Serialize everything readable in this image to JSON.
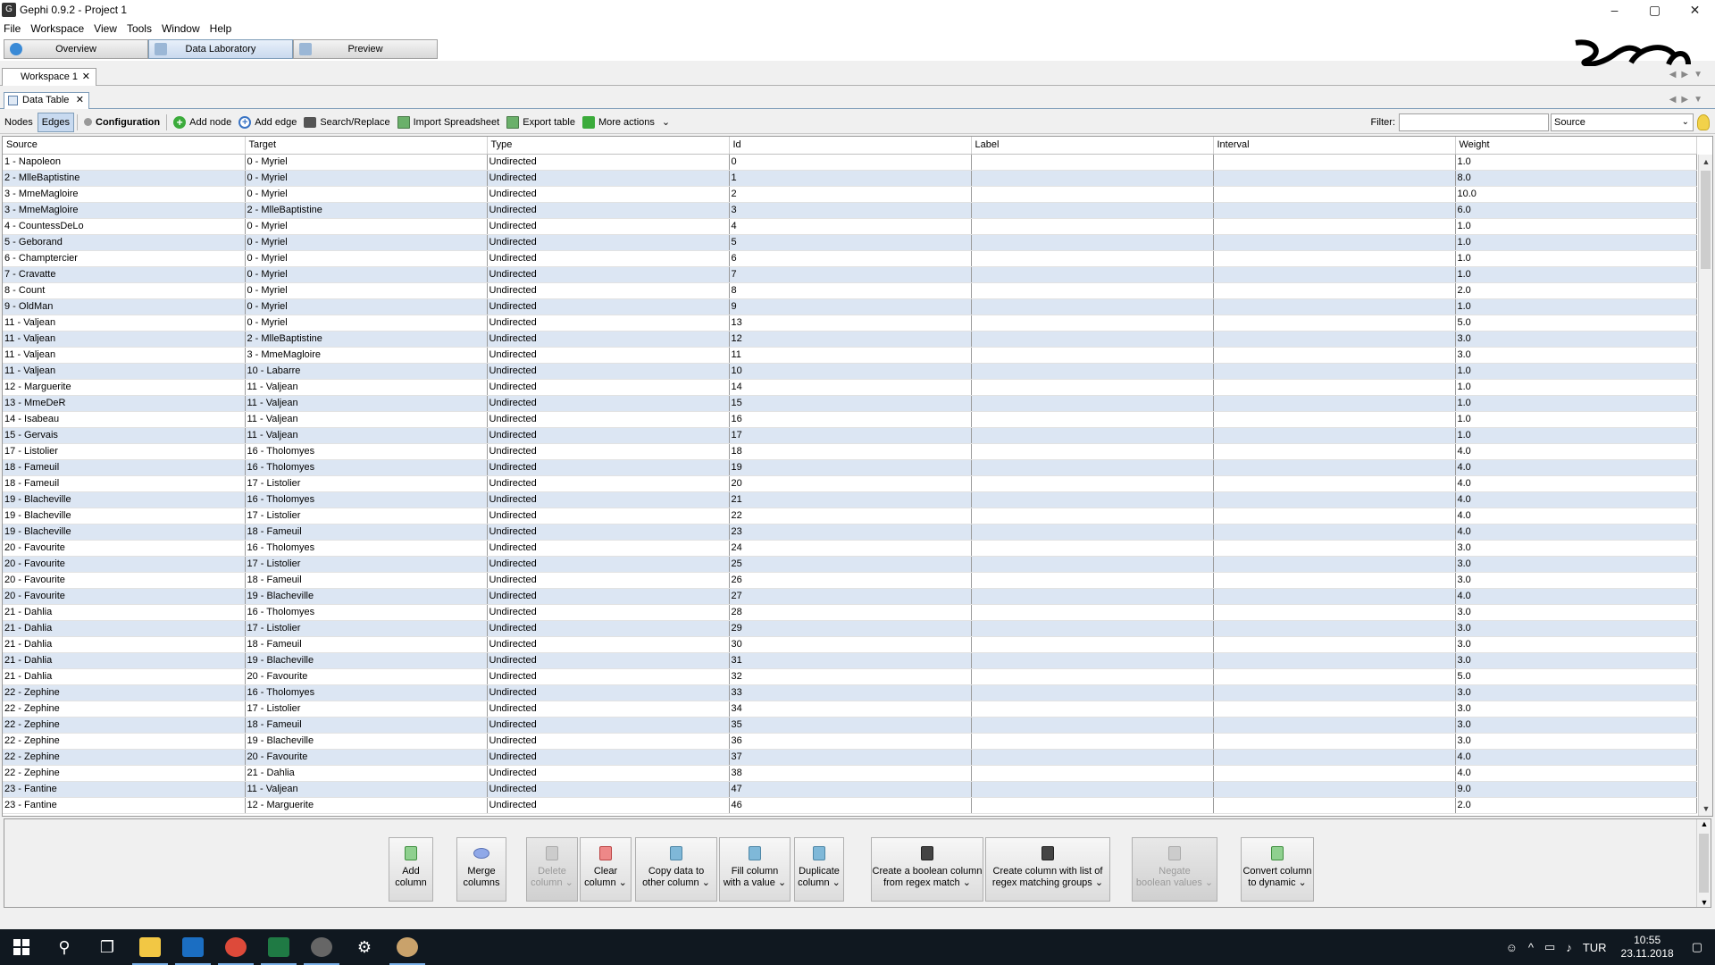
{
  "window": {
    "title": "Gephi 0.9.2 - Project 1",
    "min": "–",
    "max": "▢",
    "close": "✕"
  },
  "menu": [
    "File",
    "Workspace",
    "View",
    "Tools",
    "Window",
    "Help"
  ],
  "modes": [
    {
      "label": "Overview",
      "active": false
    },
    {
      "label": "Data Laboratory",
      "active": true
    },
    {
      "label": "Preview",
      "active": false
    }
  ],
  "workspace_tab": {
    "label": "Workspace 1",
    "close": "✕"
  },
  "panel_tab": {
    "label": "Data Table",
    "close": "✕"
  },
  "toolbar": {
    "nodes": "Nodes",
    "edges": "Edges",
    "configuration": "Configuration",
    "add_node": "Add node",
    "add_edge": "Add edge",
    "search_replace": "Search/Replace",
    "import_spreadsheet": "Import Spreadsheet",
    "export_table": "Export table",
    "more_actions": "More actions",
    "filter_label": "Filter:",
    "filter_value": "",
    "filter_column": "Source"
  },
  "table": {
    "columns": [
      "Source",
      "Target",
      "Type",
      "Id",
      "Label",
      "Interval",
      "Weight"
    ],
    "rows": [
      [
        "1 - Napoleon",
        "0 - Myriel",
        "Undirected",
        "0",
        "",
        "",
        "1.0"
      ],
      [
        "2 - MlleBaptistine",
        "0 - Myriel",
        "Undirected",
        "1",
        "",
        "",
        "8.0"
      ],
      [
        "3 - MmeMagloire",
        "0 - Myriel",
        "Undirected",
        "2",
        "",
        "",
        "10.0"
      ],
      [
        "3 - MmeMagloire",
        "2 - MlleBaptistine",
        "Undirected",
        "3",
        "",
        "",
        "6.0"
      ],
      [
        "4 - CountessDeLo",
        "0 - Myriel",
        "Undirected",
        "4",
        "",
        "",
        "1.0"
      ],
      [
        "5 - Geborand",
        "0 - Myriel",
        "Undirected",
        "5",
        "",
        "",
        "1.0"
      ],
      [
        "6 - Champtercier",
        "0 - Myriel",
        "Undirected",
        "6",
        "",
        "",
        "1.0"
      ],
      [
        "7 - Cravatte",
        "0 - Myriel",
        "Undirected",
        "7",
        "",
        "",
        "1.0"
      ],
      [
        "8 - Count",
        "0 - Myriel",
        "Undirected",
        "8",
        "",
        "",
        "2.0"
      ],
      [
        "9 - OldMan",
        "0 - Myriel",
        "Undirected",
        "9",
        "",
        "",
        "1.0"
      ],
      [
        "11 - Valjean",
        "0 - Myriel",
        "Undirected",
        "13",
        "",
        "",
        "5.0"
      ],
      [
        "11 - Valjean",
        "2 - MlleBaptistine",
        "Undirected",
        "12",
        "",
        "",
        "3.0"
      ],
      [
        "11 - Valjean",
        "3 - MmeMagloire",
        "Undirected",
        "11",
        "",
        "",
        "3.0"
      ],
      [
        "11 - Valjean",
        "10 - Labarre",
        "Undirected",
        "10",
        "",
        "",
        "1.0"
      ],
      [
        "12 - Marguerite",
        "11 - Valjean",
        "Undirected",
        "14",
        "",
        "",
        "1.0"
      ],
      [
        "13 - MmeDeR",
        "11 - Valjean",
        "Undirected",
        "15",
        "",
        "",
        "1.0"
      ],
      [
        "14 - Isabeau",
        "11 - Valjean",
        "Undirected",
        "16",
        "",
        "",
        "1.0"
      ],
      [
        "15 - Gervais",
        "11 - Valjean",
        "Undirected",
        "17",
        "",
        "",
        "1.0"
      ],
      [
        "17 - Listolier",
        "16 - Tholomyes",
        "Undirected",
        "18",
        "",
        "",
        "4.0"
      ],
      [
        "18 - Fameuil",
        "16 - Tholomyes",
        "Undirected",
        "19",
        "",
        "",
        "4.0"
      ],
      [
        "18 - Fameuil",
        "17 - Listolier",
        "Undirected",
        "20",
        "",
        "",
        "4.0"
      ],
      [
        "19 - Blacheville",
        "16 - Tholomyes",
        "Undirected",
        "21",
        "",
        "",
        "4.0"
      ],
      [
        "19 - Blacheville",
        "17 - Listolier",
        "Undirected",
        "22",
        "",
        "",
        "4.0"
      ],
      [
        "19 - Blacheville",
        "18 - Fameuil",
        "Undirected",
        "23",
        "",
        "",
        "4.0"
      ],
      [
        "20 - Favourite",
        "16 - Tholomyes",
        "Undirected",
        "24",
        "",
        "",
        "3.0"
      ],
      [
        "20 - Favourite",
        "17 - Listolier",
        "Undirected",
        "25",
        "",
        "",
        "3.0"
      ],
      [
        "20 - Favourite",
        "18 - Fameuil",
        "Undirected",
        "26",
        "",
        "",
        "3.0"
      ],
      [
        "20 - Favourite",
        "19 - Blacheville",
        "Undirected",
        "27",
        "",
        "",
        "4.0"
      ],
      [
        "21 - Dahlia",
        "16 - Tholomyes",
        "Undirected",
        "28",
        "",
        "",
        "3.0"
      ],
      [
        "21 - Dahlia",
        "17 - Listolier",
        "Undirected",
        "29",
        "",
        "",
        "3.0"
      ],
      [
        "21 - Dahlia",
        "18 - Fameuil",
        "Undirected",
        "30",
        "",
        "",
        "3.0"
      ],
      [
        "21 - Dahlia",
        "19 - Blacheville",
        "Undirected",
        "31",
        "",
        "",
        "3.0"
      ],
      [
        "21 - Dahlia",
        "20 - Favourite",
        "Undirected",
        "32",
        "",
        "",
        "5.0"
      ],
      [
        "22 - Zephine",
        "16 - Tholomyes",
        "Undirected",
        "33",
        "",
        "",
        "3.0"
      ],
      [
        "22 - Zephine",
        "17 - Listolier",
        "Undirected",
        "34",
        "",
        "",
        "3.0"
      ],
      [
        "22 - Zephine",
        "18 - Fameuil",
        "Undirected",
        "35",
        "",
        "",
        "3.0"
      ],
      [
        "22 - Zephine",
        "19 - Blacheville",
        "Undirected",
        "36",
        "",
        "",
        "3.0"
      ],
      [
        "22 - Zephine",
        "20 - Favourite",
        "Undirected",
        "37",
        "",
        "",
        "4.0"
      ],
      [
        "22 - Zephine",
        "21 - Dahlia",
        "Undirected",
        "38",
        "",
        "",
        "4.0"
      ],
      [
        "23 - Fantine",
        "11 - Valjean",
        "Undirected",
        "47",
        "",
        "",
        "9.0"
      ],
      [
        "23 - Fantine",
        "12 - Marguerite",
        "Undirected",
        "46",
        "",
        "",
        "2.0"
      ]
    ]
  },
  "column_actions": [
    {
      "name": "add-column-button",
      "lines": [
        "Add",
        "column"
      ],
      "icon": "green",
      "disabled": false
    },
    {
      "name": "merge-columns-button",
      "lines": [
        "Merge",
        "columns"
      ],
      "icon": "oval",
      "disabled": false
    },
    {
      "name": "delete-column-button",
      "lines": [
        "Delete",
        "column ⌄"
      ],
      "icon": "grey",
      "disabled": true
    },
    {
      "name": "clear-column-button",
      "lines": [
        "Clear",
        "column ⌄"
      ],
      "icon": "red",
      "disabled": false
    },
    {
      "name": "copy-data-button",
      "lines": [
        "Copy data to",
        "other column ⌄"
      ],
      "icon": "blue",
      "disabled": false
    },
    {
      "name": "fill-column-button",
      "lines": [
        "Fill column",
        "with a value ⌄"
      ],
      "icon": "blue",
      "disabled": false
    },
    {
      "name": "duplicate-column-button",
      "lines": [
        "Duplicate",
        "column ⌄"
      ],
      "icon": "blue",
      "disabled": false
    },
    {
      "name": "boolean-regex-button",
      "lines": [
        "Create a boolean column",
        "from regex match ⌄"
      ],
      "icon": "bino",
      "disabled": false
    },
    {
      "name": "regex-groups-button",
      "lines": [
        "Create column with list of",
        "regex matching groups ⌄"
      ],
      "icon": "bino",
      "disabled": false
    },
    {
      "name": "negate-boolean-button",
      "lines": [
        "Negate",
        "boolean values ⌄"
      ],
      "icon": "grey",
      "disabled": true
    },
    {
      "name": "convert-dynamic-button",
      "lines": [
        "Convert column",
        "to dynamic ⌄"
      ],
      "icon": "green",
      "disabled": false
    }
  ],
  "taskbar": {
    "language": "TUR",
    "time": "10:55",
    "date": "23.11.2018"
  }
}
